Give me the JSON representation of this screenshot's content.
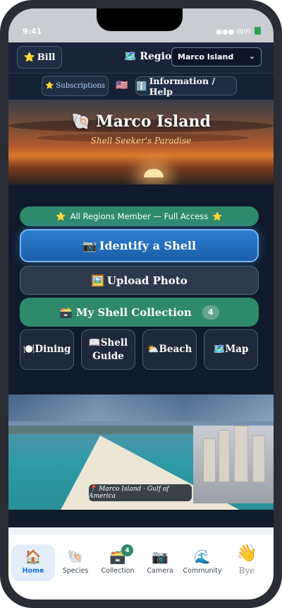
{
  "status": {
    "time": "9:41",
    "signal": "●●● WiFi"
  },
  "topbar": {
    "bill_label": "Bill",
    "region_label": "Region:",
    "region_value": "Marco Island"
  },
  "subbar": {
    "subscriptions_label": "Subscriptions",
    "info_label": "Information / Help"
  },
  "hero": {
    "title": "Marco Island",
    "subtitle": "Shell Seeker's Paradise"
  },
  "main": {
    "member_text": "All Regions Member — Full Access",
    "identify_label": "Identify a Shell",
    "upload_label": "Upload Photo",
    "collection_label": "My Shell Collection",
    "collection_count": "4",
    "tiles": [
      {
        "label": "Dining",
        "icon": "plate-icon"
      },
      {
        "label": "Shell Guide",
        "icon": "book-icon"
      },
      {
        "label": "Beach",
        "icon": "sun-cloud-icon"
      },
      {
        "label": "Map",
        "icon": "map-icon"
      }
    ]
  },
  "photo": {
    "caption": "📍 Marco Island · Gulf of America"
  },
  "tabbar": {
    "items": [
      {
        "label": "Home",
        "icon": "house-icon",
        "active": true
      },
      {
        "label": "Species",
        "icon": "shell-icon"
      },
      {
        "label": "Collection",
        "icon": "box-icon",
        "badge": "4"
      },
      {
        "label": "Camera",
        "icon": "camera-icon"
      },
      {
        "label": "Community",
        "icon": "wave-icon"
      }
    ],
    "bye_label": "Bye"
  },
  "colors": {
    "accent_green": "#2f8a6c",
    "accent_blue": "#2e7fd0",
    "background": "#0f1a2a"
  }
}
